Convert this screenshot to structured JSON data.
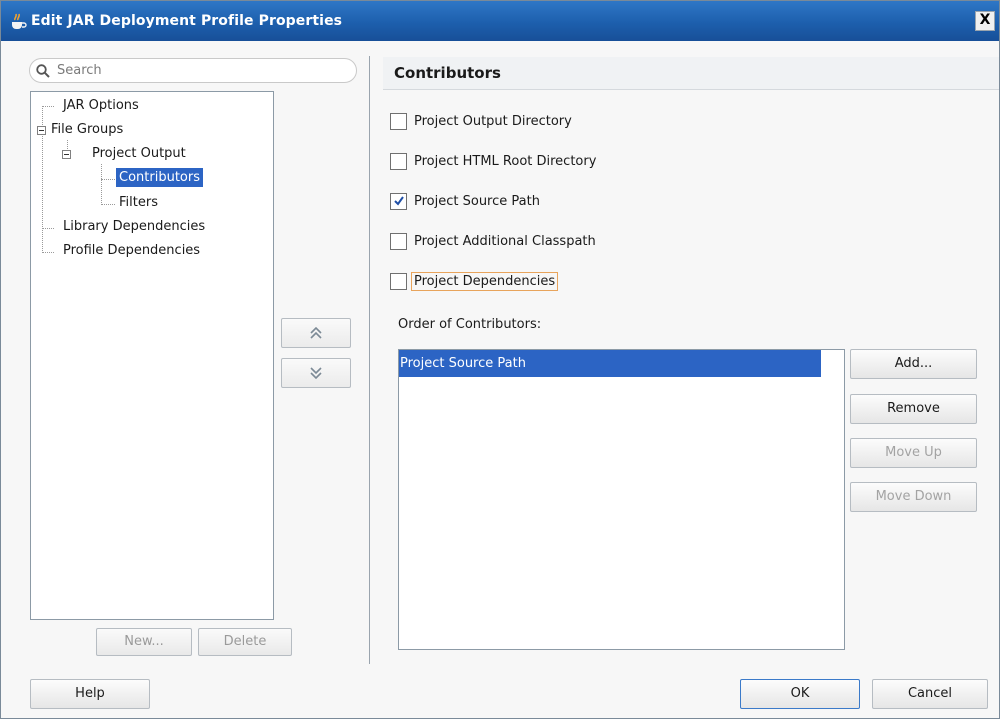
{
  "window": {
    "title": "Edit JAR Deployment Profile Properties",
    "close_label": "X"
  },
  "search": {
    "placeholder": "Search"
  },
  "tree": {
    "items": [
      {
        "label": "JAR Options"
      },
      {
        "label": "File Groups"
      },
      {
        "label": "Project Output"
      },
      {
        "label": "Contributors"
      },
      {
        "label": "Filters"
      },
      {
        "label": "Library Dependencies"
      },
      {
        "label": "Profile Dependencies"
      }
    ]
  },
  "left_buttons": {
    "new": "New...",
    "delete": "Delete"
  },
  "panel": {
    "heading": "Contributors",
    "checkboxes": [
      {
        "label": "Project Output Directory",
        "checked": false
      },
      {
        "label": "Project HTML Root Directory",
        "checked": false
      },
      {
        "label": "Project Source Path",
        "checked": true
      },
      {
        "label": "Project Additional Classpath",
        "checked": false
      },
      {
        "label": "Project Dependencies",
        "checked": false
      }
    ],
    "order_label": "Order of Contributors:",
    "order_items": [
      "Project Source Path"
    ],
    "buttons": {
      "add": "Add...",
      "remove": "Remove",
      "move_up": "Move Up",
      "move_down": "Move Down"
    }
  },
  "footer": {
    "help": "Help",
    "ok": "OK",
    "cancel": "Cancel"
  },
  "colors": {
    "selection": "#2c64c4",
    "titlebar": "#1d5fad"
  }
}
